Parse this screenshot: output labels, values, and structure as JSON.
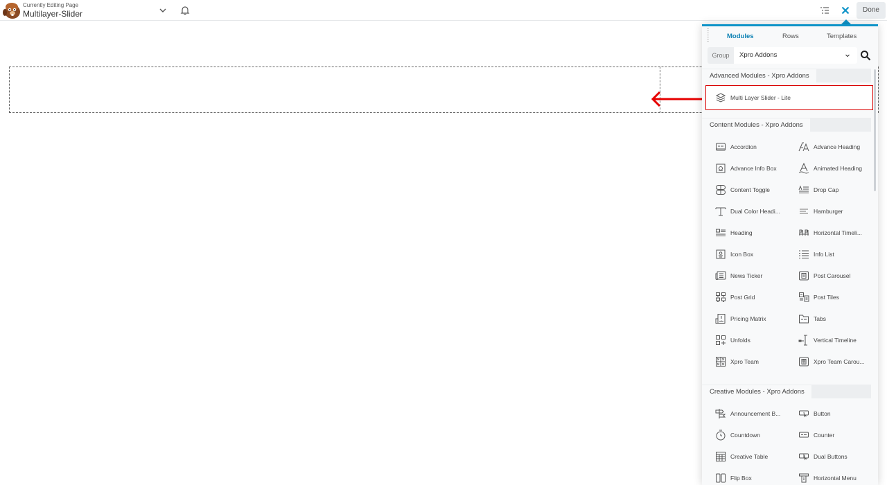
{
  "topbar": {
    "editing_label": "Currently Editing Page",
    "page_name": "Multilayer-Slider",
    "done_label": "Done"
  },
  "panel": {
    "tabs": [
      {
        "label": "Modules",
        "active": true
      },
      {
        "label": "Rows",
        "active": false
      },
      {
        "label": "Templates",
        "active": false
      }
    ],
    "group_label": "Group",
    "group_value": "Xpro Addons",
    "sections": [
      {
        "title": "Advanced Modules - Xpro Addons",
        "items": [
          {
            "label": "Multi Layer Slider - Lite",
            "icon": "layers-icon"
          }
        ]
      },
      {
        "title": "Content Modules - Xpro Addons",
        "items": [
          {
            "label": "Accordion",
            "icon": "accordion-icon"
          },
          {
            "label": "Advance Heading",
            "icon": "advance-heading-icon"
          },
          {
            "label": "Advance Info Box",
            "icon": "info-box-icon"
          },
          {
            "label": "Animated Heading",
            "icon": "animated-heading-icon"
          },
          {
            "label": "Content Toggle",
            "icon": "content-toggle-icon"
          },
          {
            "label": "Drop Cap",
            "icon": "drop-cap-icon"
          },
          {
            "label": "Dual Color Headi...",
            "icon": "dual-color-heading-icon"
          },
          {
            "label": "Hamburger",
            "icon": "hamburger-icon"
          },
          {
            "label": "Heading",
            "icon": "heading-icon"
          },
          {
            "label": "Horizontal Timeli...",
            "icon": "horizontal-timeline-icon"
          },
          {
            "label": "Icon Box",
            "icon": "icon-box-icon"
          },
          {
            "label": "Info List",
            "icon": "info-list-icon"
          },
          {
            "label": "News Ticker",
            "icon": "news-ticker-icon"
          },
          {
            "label": "Post Carousel",
            "icon": "post-carousel-icon"
          },
          {
            "label": "Post Grid",
            "icon": "post-grid-icon"
          },
          {
            "label": "Post Tiles",
            "icon": "post-tiles-icon"
          },
          {
            "label": "Pricing Matrix",
            "icon": "pricing-matrix-icon"
          },
          {
            "label": "Tabs",
            "icon": "tabs-icon"
          },
          {
            "label": "Unfolds",
            "icon": "unfolds-icon"
          },
          {
            "label": "Vertical Timeline",
            "icon": "vertical-timeline-icon"
          },
          {
            "label": "Xpro Team",
            "icon": "team-icon"
          },
          {
            "label": "Xpro Team Carou...",
            "icon": "team-carousel-icon"
          }
        ]
      },
      {
        "title": "Creative Modules - Xpro Addons",
        "items": [
          {
            "label": "Announcement B...",
            "icon": "announcement-icon"
          },
          {
            "label": "Button",
            "icon": "button-icon"
          },
          {
            "label": "Countdown",
            "icon": "countdown-icon"
          },
          {
            "label": "Counter",
            "icon": "counter-icon"
          },
          {
            "label": "Creative Table",
            "icon": "table-icon"
          },
          {
            "label": "Dual Buttons",
            "icon": "dual-buttons-icon"
          },
          {
            "label": "Flip Box",
            "icon": "flip-box-icon"
          },
          {
            "label": "Horizontal Menu",
            "icon": "horizontal-menu-icon"
          }
        ]
      }
    ]
  },
  "colors": {
    "accent": "#0e93c8",
    "highlight": "#d90000"
  }
}
